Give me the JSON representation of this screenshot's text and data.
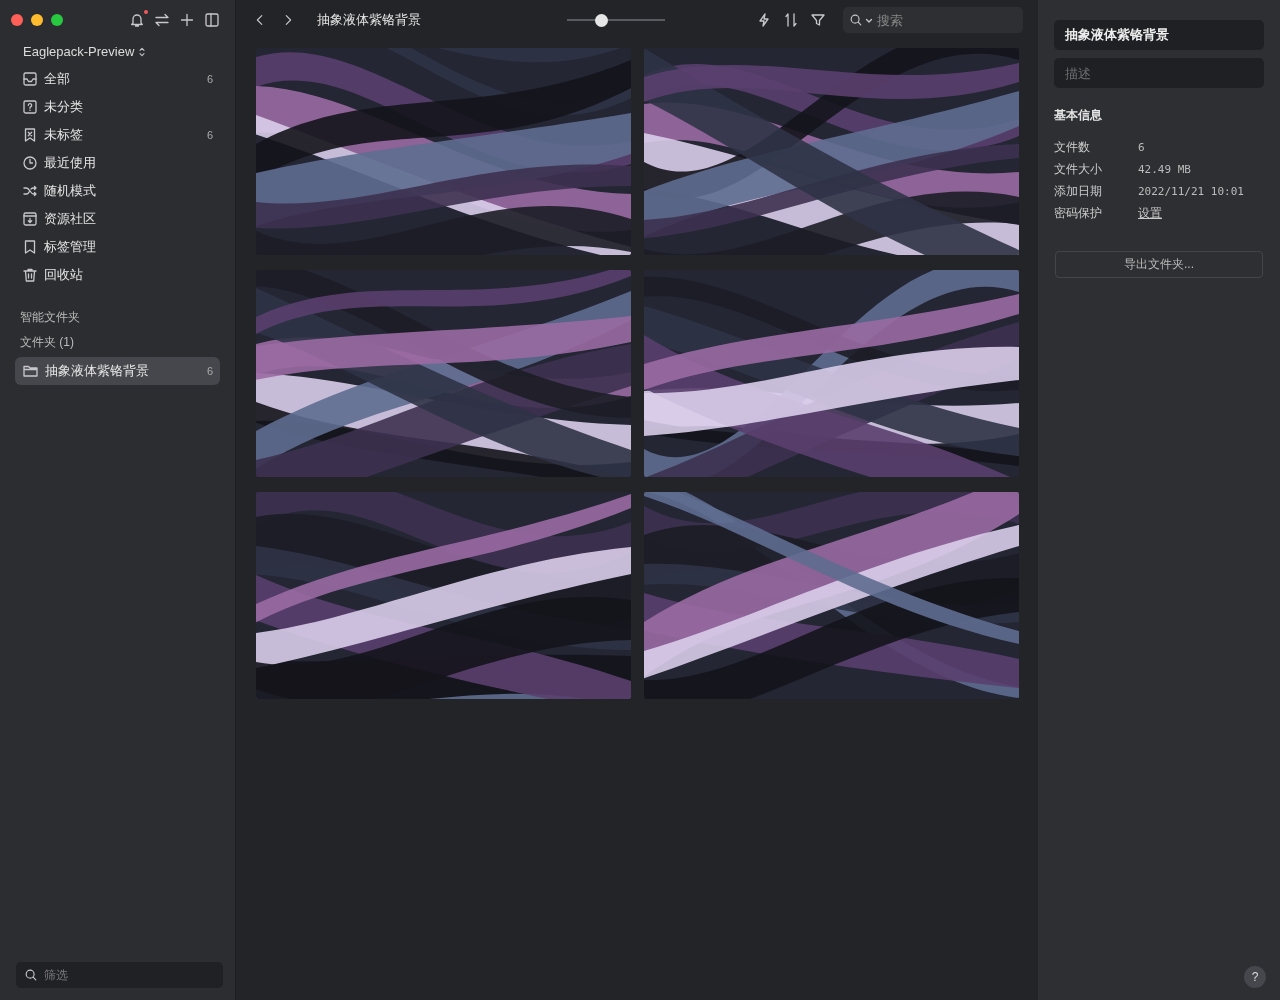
{
  "sidebar": {
    "notification": true,
    "workspace": "Eaglepack-Preview",
    "items": [
      {
        "kind": "all",
        "label": "全部",
        "count": "6",
        "selected": false
      },
      {
        "kind": "uncategorized",
        "label": "未分类",
        "selected": false
      },
      {
        "kind": "untagged",
        "label": "未标签",
        "count": "6",
        "selected": false
      },
      {
        "kind": "recent",
        "label": "最近使用",
        "selected": false
      },
      {
        "kind": "random",
        "label": "随机模式",
        "selected": false
      },
      {
        "kind": "community",
        "label": "资源社区",
        "selected": false
      },
      {
        "kind": "tags",
        "label": "标签管理",
        "selected": false
      },
      {
        "kind": "trash",
        "label": "回收站",
        "selected": false
      }
    ],
    "smart_folders_heading": "智能文件夹",
    "folders_heading": "文件夹 (1)",
    "folders": [
      {
        "label": "抽象液体紫铬背景",
        "count": "6",
        "selected": true
      }
    ],
    "filter": {
      "placeholder": "筛选"
    }
  },
  "toolbar": {
    "title": "抽象液体紫铬背景",
    "zoom_slider": {
      "level": 0.35
    },
    "search": {
      "placeholder": "搜索"
    }
  },
  "inspector": {
    "name": "抽象液体紫铬背景",
    "description": {
      "placeholder": "描述"
    },
    "heading": "基本信息",
    "rows": [
      {
        "label": "文件数",
        "value": "6",
        "kind": "text"
      },
      {
        "label": "文件大小",
        "value": "42.49 MB",
        "kind": "text"
      },
      {
        "label": "添加日期",
        "value": "2022/11/21 10:01",
        "kind": "text"
      },
      {
        "label": "密码保护",
        "value": "设置",
        "kind": "link"
      }
    ],
    "export_button": "导出文件夹...",
    "help": "?"
  }
}
